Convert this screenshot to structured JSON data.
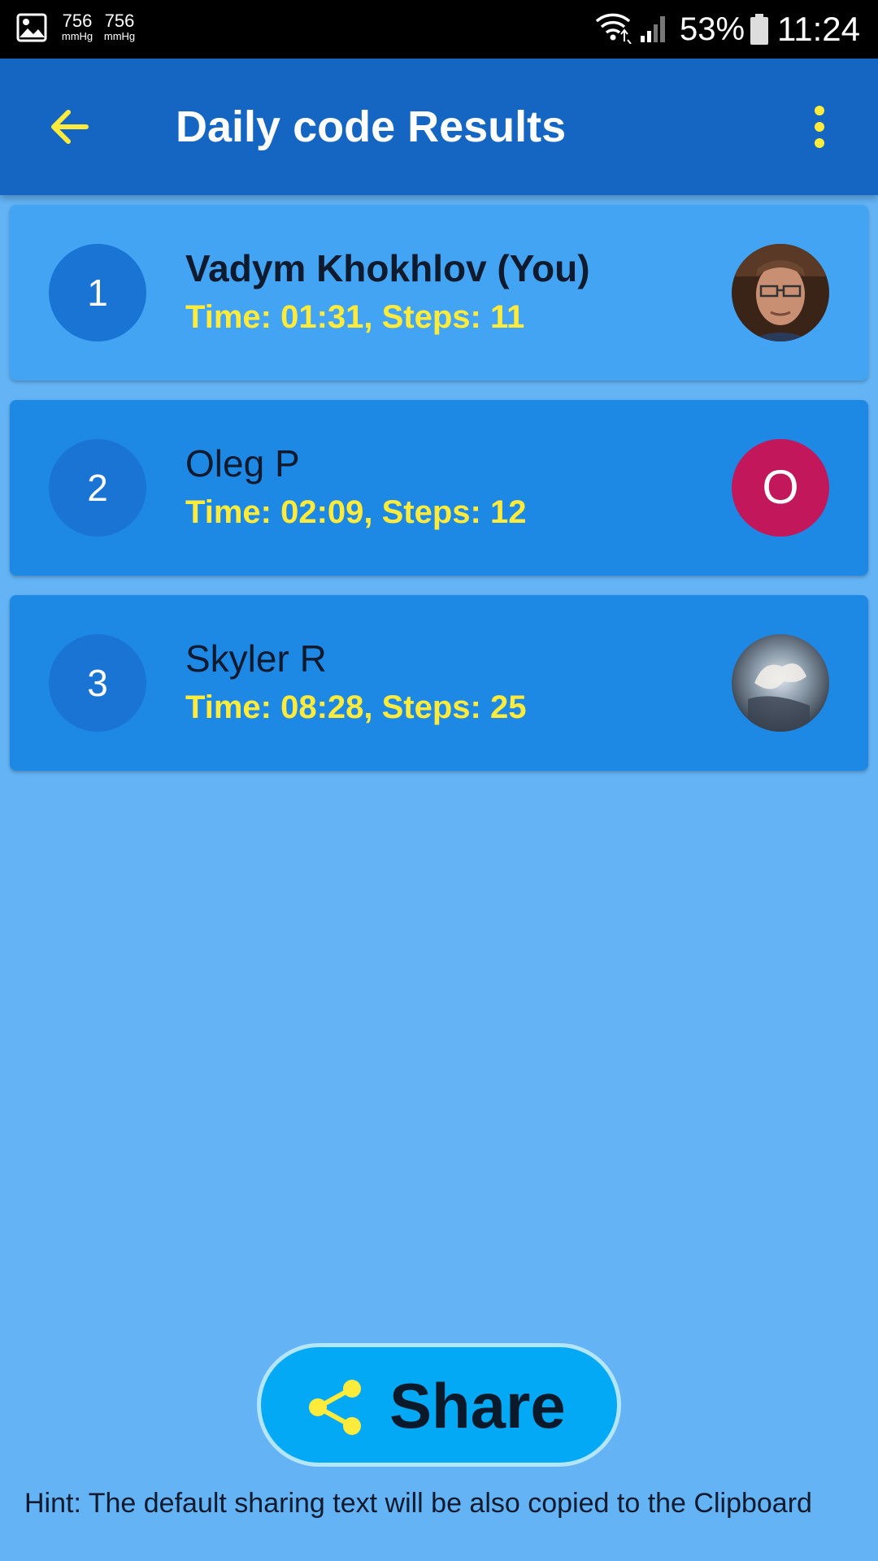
{
  "status_bar": {
    "pressure_1": "756",
    "pressure_1_unit": "mmHg",
    "pressure_2": "756",
    "pressure_2_unit": "mmHg",
    "battery": "53%",
    "time": "11:24"
  },
  "appbar": {
    "title": "Daily code Results",
    "back_icon": "arrow-back-icon",
    "more_icon": "more-vert-icon"
  },
  "results": [
    {
      "rank": "1",
      "name": "Vadym Khokhlov (You)",
      "stats": "Time: 01:31, Steps: 11",
      "avatar": "photo"
    },
    {
      "rank": "2",
      "name": "Oleg P",
      "stats": "Time: 02:09, Steps: 12",
      "avatar_letter": "O"
    },
    {
      "rank": "3",
      "name": "Skyler R",
      "stats": "Time: 08:28, Steps: 25",
      "avatar": "photo"
    }
  ],
  "share": {
    "label": "Share",
    "icon": "share-icon"
  },
  "hint": "Hint: The default sharing text will be also copied to the Clipboard",
  "colors": {
    "appbar": "#1566c2",
    "background": "#64b3f5",
    "accent_yellow": "#ffeb3b",
    "card_highlight": "#42a4f2",
    "card": "#1e88e5",
    "share_button": "#03a9f4",
    "letter_avatar": "#c2185b"
  }
}
